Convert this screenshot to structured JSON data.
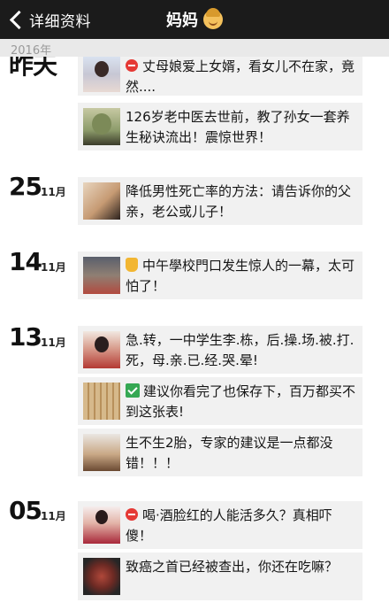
{
  "nav": {
    "back_label": "详细资料",
    "title": "妈妈"
  },
  "year": "2016年",
  "groups": [
    {
      "day": "昨天",
      "month": "",
      "posts": [
        {
          "icon": "red-circle-icon",
          "text": "丈母娘爱上女婿，看女儿不在家，竟然...."
        },
        {
          "icon": "",
          "text": "126岁老中医去世前，教了孙女一套养生秘诀流出！震惊世界！"
        }
      ]
    },
    {
      "day": "25",
      "month": "11月",
      "posts": [
        {
          "icon": "",
          "text": "降低男性死亡率的方法：请告诉你的父亲，老公或儿子！"
        }
      ]
    },
    {
      "day": "14",
      "month": "11月",
      "posts": [
        {
          "icon": "hand-icon",
          "text": "中午學校門口发生惊人的一幕，太可怕了！"
        }
      ]
    },
    {
      "day": "13",
      "month": "11月",
      "posts": [
        {
          "icon": "",
          "text": "急.转，一中学生李.栋，后.操.场.被.打.死，母.亲.已.经.哭.晕!"
        },
        {
          "icon": "check-mark-icon",
          "text": "建议你看完了也保存下，百万都买不到这张表!"
        },
        {
          "icon": "",
          "text": "生不生2胎，专家的建议是一点都没错！！！"
        }
      ]
    },
    {
      "day": "05",
      "month": "11月",
      "posts": [
        {
          "icon": "red-circle-icon",
          "text": "喝·酒脸红的人能活多久？真相吓傻！"
        },
        {
          "icon": "",
          "text": "致癌之首已经被查出，你还在吃嘛？"
        }
      ]
    }
  ]
}
